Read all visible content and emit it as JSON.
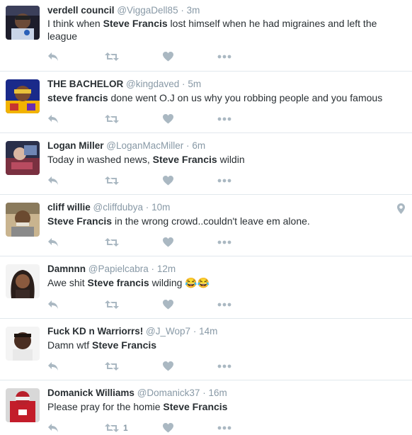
{
  "colors": {
    "icon": "#aab8c2",
    "name": "#292f33",
    "meta": "#8899a6",
    "divider": "#e1e8ed"
  },
  "tweets": [
    {
      "name": "verdell council",
      "handle": "@ViggaDell85",
      "time": "3m",
      "text_before": "I think when ",
      "highlight": "Steve Francis",
      "text_after": " lost himself when he had migraines and left the league",
      "retweet_count": ""
    },
    {
      "name": "THE BACHELOR",
      "handle": "@kingdaved",
      "time": "5m",
      "text_before": "",
      "highlight": "steve francis",
      "text_after": " done went O.J on us why you robbing people and you famous",
      "retweet_count": ""
    },
    {
      "name": "Logan Miller",
      "handle": "@LoganMacMiller",
      "time": "6m",
      "text_before": "Today in washed news, ",
      "highlight": "Steve Francis",
      "text_after": " wildin",
      "retweet_count": ""
    },
    {
      "name": "cliff willie",
      "handle": "@cliffdubya",
      "time": "10m",
      "text_before": "",
      "highlight": "Steve Francis",
      "text_after": " in the wrong crowd..couldn't leave em alone.",
      "retweet_count": "",
      "has_location": true
    },
    {
      "name": "Damnnn",
      "handle": "@Papielcabra",
      "time": "12m",
      "text_before": "Awe shit ",
      "highlight": "Steve francis",
      "text_after": " wilding 😂😂",
      "retweet_count": ""
    },
    {
      "name": "Fuck KD n Warriorrs!",
      "handle": "@J_Wop7",
      "time": "14m",
      "text_before": "Damn wtf ",
      "highlight": "Steve Francis",
      "text_after": "",
      "retweet_count": ""
    },
    {
      "name": "Domanick Williams",
      "handle": "@Domanick37",
      "time": "16m",
      "text_before": "Please pray for the homie ",
      "highlight": "Steve Francis",
      "text_after": "",
      "retweet_count": "1"
    }
  ]
}
